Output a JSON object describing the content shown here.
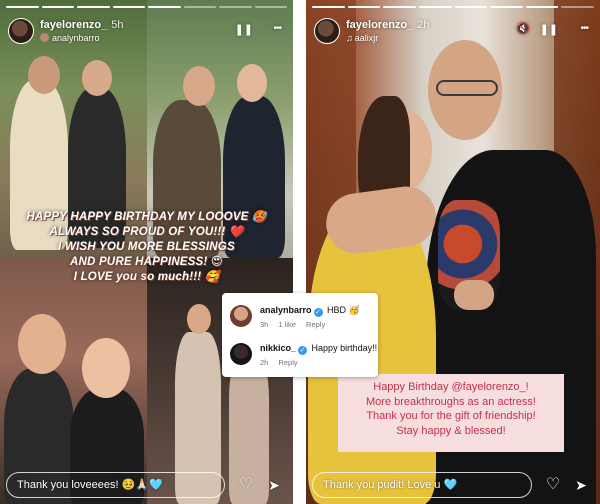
{
  "left_story": {
    "username": "fayelorenzo_",
    "time": "5h",
    "mention": "analynbarro",
    "caption_lines": [
      "HAPPY HAPPY BIRTHDAY MY LOOOVE 🥵",
      "ALWAYS SO PROUD OF YOU!!! ❤️",
      "I WISH YOU MORE BLESSINGS",
      "AND PURE HAPPINESS! 😍",
      "I LOVE you so much!!! 🥰"
    ],
    "reply_text": "Thank you loveeees! 🥹🙏🏻🩵"
  },
  "comments": [
    {
      "username": "analynbarro",
      "text": "HBD 🥳",
      "time": "3h",
      "likes": "1 like",
      "reply": "Reply"
    },
    {
      "username": "nikkico_",
      "text": "Happy birthday!!",
      "time": "2h",
      "reply": "Reply"
    }
  ],
  "right_story": {
    "username": "fayelorenzo_",
    "time": "2h",
    "music": "aalixjr",
    "message_lines": [
      "Happy Birthday @fayelorenzo_!",
      "More breakthroughs as an actress!",
      "Thank you for the gift of friendship!",
      "Stay happy & blessed!"
    ],
    "reply_text": "Thank you pudit! Love u 🩵"
  },
  "icons": {
    "mute": "🔇",
    "pause": "❚❚",
    "more": "•••",
    "heart": "♡",
    "send": "➤",
    "check": "✓"
  },
  "colors": {
    "pink_box": "#f6dede",
    "pink_text": "#c4314b",
    "verified": "#3897f0"
  }
}
